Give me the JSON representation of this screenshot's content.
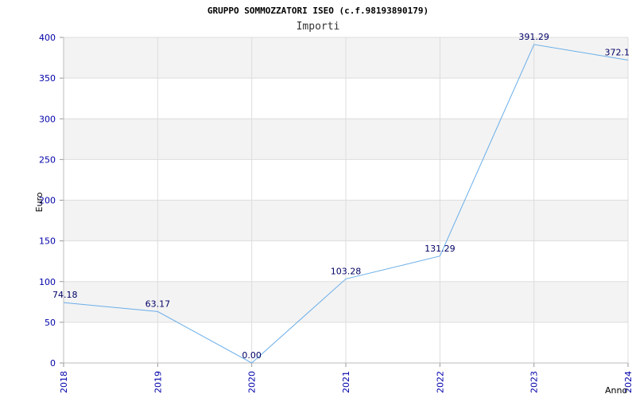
{
  "chart_data": {
    "type": "line",
    "title": "GRUPPO SOMMOZZATORI ISEO (c.f.98193890179)",
    "subtitle": "Importi",
    "xlabel": "Anno",
    "ylabel": "Euro",
    "categories": [
      "2018",
      "2019",
      "2020",
      "2021",
      "2022",
      "2023",
      "2024"
    ],
    "values": [
      74.18,
      63.17,
      0.0,
      103.28,
      131.29,
      391.29,
      372.1
    ],
    "data_labels": [
      "74.18",
      "63.17",
      "0.00",
      "103.28",
      "131.29",
      "391.29",
      "372.1"
    ],
    "yticks": [
      0,
      50,
      100,
      150,
      200,
      250,
      300,
      350,
      400
    ],
    "ylim": [
      0,
      400
    ],
    "grid": true,
    "colors": {
      "line": "#6aaee8",
      "band": "#f3f3f3",
      "grid": "#dddddd",
      "tick_text": "#0000aa",
      "label_text": "#000066"
    }
  }
}
